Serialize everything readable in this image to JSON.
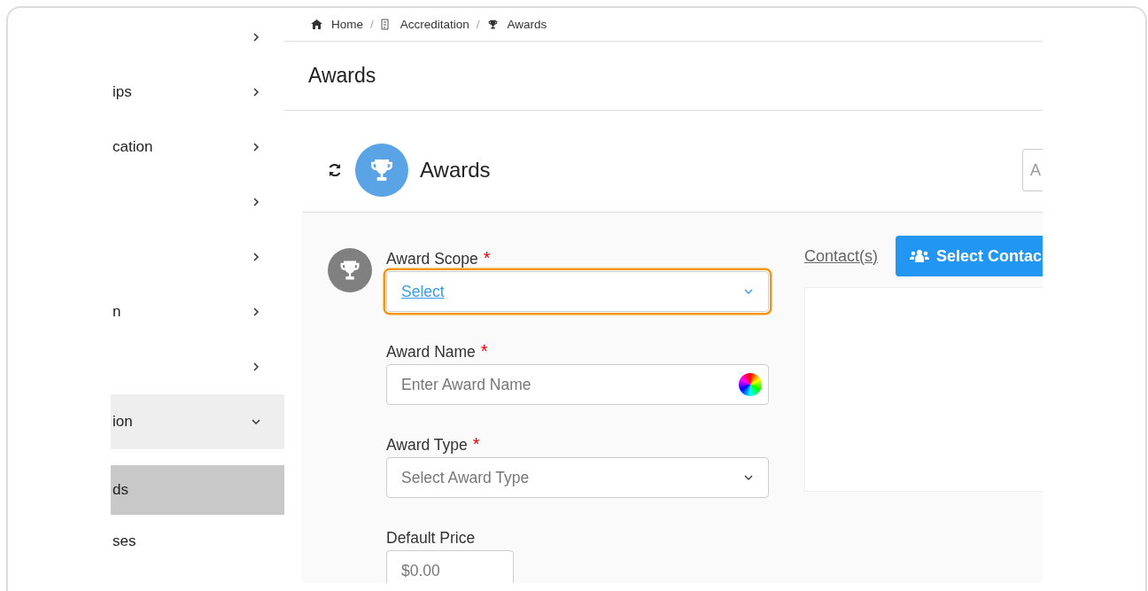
{
  "sidebar": {
    "items": [
      {
        "selected": false,
        "expanded": false
      },
      {
        "label": "ips",
        "selected": false,
        "expanded": false
      },
      {
        "label": "cation",
        "selected": false,
        "expanded": false
      },
      {
        "selected": false,
        "expanded": false
      },
      {
        "selected": false,
        "expanded": false
      },
      {
        "label": "n",
        "selected": false,
        "expanded": false
      },
      {
        "selected": false,
        "expanded": false
      },
      {
        "label": "ion",
        "selected": false,
        "expanded": true,
        "children": [
          {
            "label": "ds",
            "selected": true
          },
          {
            "label": "ses",
            "selected": false
          }
        ]
      }
    ]
  },
  "breadcrumb": [
    {
      "label": "Home",
      "kind": "home"
    },
    {
      "separator": "/",
      "label": "Accreditation",
      "kind": "doc"
    },
    {
      "separator": "/",
      "label": "Awards",
      "kind": "trophy"
    }
  ],
  "page_title": "Awards",
  "card": {
    "title": "Awards",
    "header_field": {
      "text": "A"
    },
    "fields": [
      {
        "kind": "select",
        "label": "Award Scope",
        "required_mark": "*",
        "value": "Select",
        "focused": true
      },
      {
        "kind": "text",
        "label": "Award Name",
        "required_mark": "*",
        "placeholder": "Enter Award Name",
        "focused": false
      },
      {
        "kind": "select",
        "label": "Award Type",
        "required_mark": "*",
        "placeholder": "Select Award Type",
        "focused": false
      },
      {
        "kind": "price",
        "label": "Default Price",
        "placeholder": "$0.00",
        "focused": false
      }
    ],
    "contacts": {
      "label": "Contact(s)",
      "button": "Select Contac"
    }
  }
}
